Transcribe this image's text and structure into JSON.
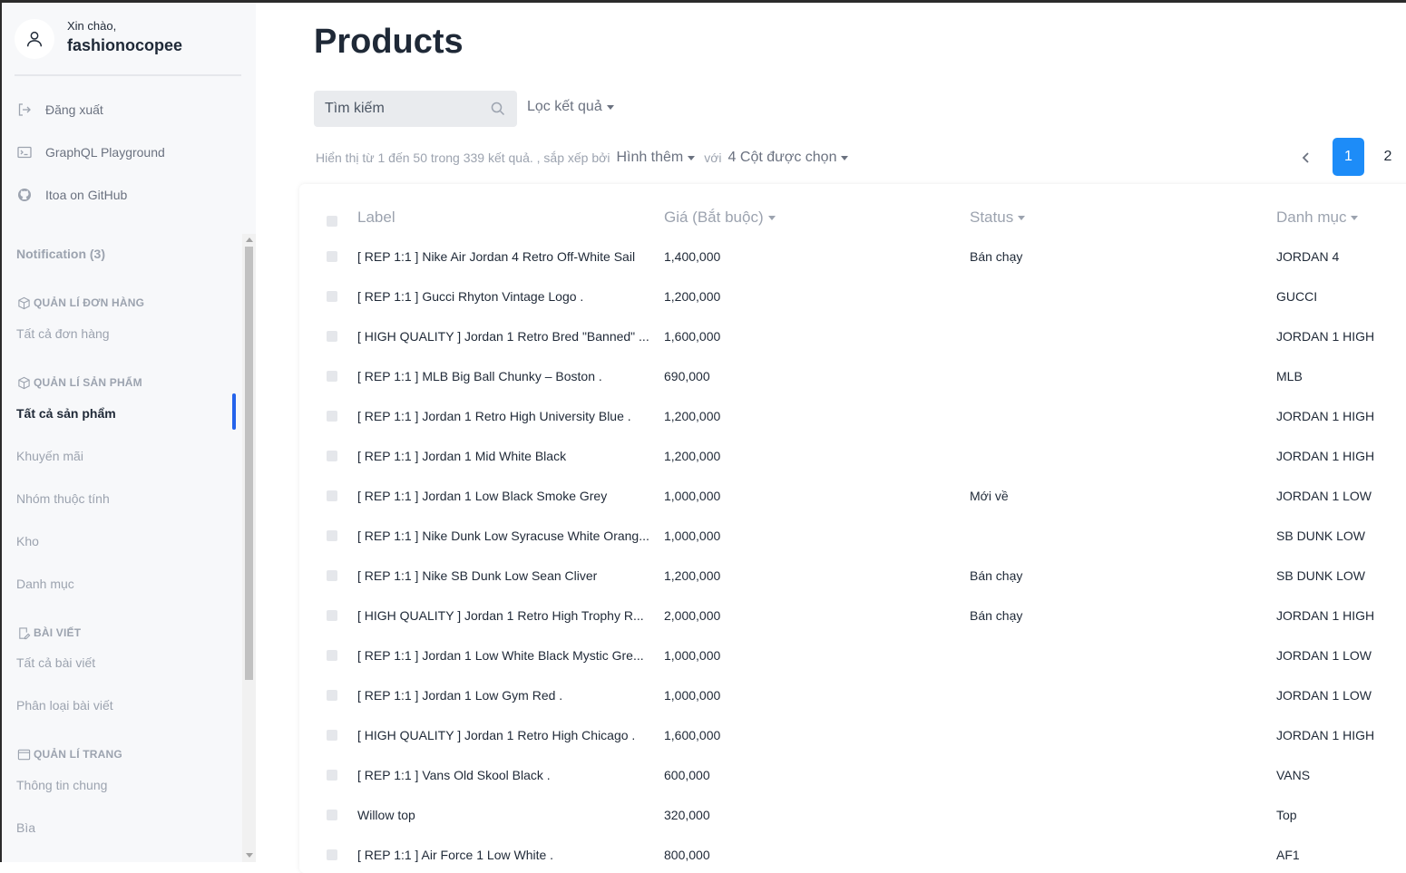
{
  "user": {
    "greeting": "Xin chào,",
    "name": "fashionocopee"
  },
  "sidebar": {
    "links": [
      {
        "label": "Đăng xuất",
        "icon": "logout-icon"
      },
      {
        "label": "GraphQL Playground",
        "icon": "terminal-icon"
      },
      {
        "label": "Itoa on GitHub",
        "icon": "github-icon"
      }
    ],
    "notification": "Notification (3)",
    "sections": [
      {
        "title": "QUẢN LÍ ĐƠN HÀNG",
        "icon": "box-icon",
        "items": [
          "Tất cả đơn hàng"
        ]
      },
      {
        "title": "QUẢN LÍ SẢN PHẨM",
        "icon": "box-icon",
        "items": [
          "Tất cả sản phẩm",
          "Khuyến mãi",
          "Nhóm thuộc tính",
          "Kho",
          "Danh mục"
        ]
      },
      {
        "title": "BÀI VIẾT",
        "icon": "edit-document-icon",
        "items": [
          "Tất cả bài viết",
          "Phân loại bài viết"
        ]
      },
      {
        "title": "QUẢN LÍ TRANG",
        "icon": "window-icon",
        "items": [
          "Thông tin chung",
          "Bìa"
        ]
      }
    ],
    "active_item": "Tất cả sản phẩm"
  },
  "page": {
    "title": "Products"
  },
  "search": {
    "placeholder": "Tìm kiếm"
  },
  "filter": {
    "label": "Lọc kết quả"
  },
  "info": {
    "text": "Hiển thị từ 1 đến 50 trong 339 kết quả. , sắp xếp bởi",
    "sort_by": "Hình thêm",
    "with": "với",
    "columns": "4 Cột được chọn"
  },
  "pagination": {
    "current": "1",
    "next": "2"
  },
  "table": {
    "headers": [
      "Label",
      "Giá (Bắt buộc)",
      "Status",
      "Danh mục"
    ],
    "rows": [
      [
        "[ REP 1:1 ] Nike Air Jordan 4 Retro Off-White Sail",
        "1,400,000",
        "Bán chạy",
        "JORDAN 4"
      ],
      [
        "[ REP 1:1 ] Gucci Rhyton Vintage Logo .",
        "1,200,000",
        "",
        "GUCCI"
      ],
      [
        "[ HIGH QUALITY ] Jordan 1 Retro Bred \"Banned\" ...",
        "1,600,000",
        "",
        "JORDAN 1 HIGH"
      ],
      [
        "[ REP 1:1 ] MLB Big Ball Chunky – Boston .",
        "690,000",
        "",
        "MLB"
      ],
      [
        "[ REP 1:1 ] Jordan 1 Retro High University Blue .",
        "1,200,000",
        "",
        "JORDAN 1 HIGH"
      ],
      [
        "[ REP 1:1 ] Jordan 1 Mid White Black",
        "1,200,000",
        "",
        "JORDAN 1 HIGH"
      ],
      [
        "[ REP 1:1 ] Jordan 1 Low Black Smoke Grey",
        "1,000,000",
        "Mới về",
        "JORDAN 1 LOW"
      ],
      [
        "[ REP 1:1 ] Nike Dunk Low Syracuse White Orang...",
        "1,000,000",
        "",
        "SB DUNK LOW"
      ],
      [
        "[ REP 1:1 ] Nike SB Dunk Low Sean Cliver",
        "1,200,000",
        "Bán chạy",
        "SB DUNK LOW"
      ],
      [
        "[ HIGH QUALITY ] Jordan 1 Retro High Trophy R...",
        "2,000,000",
        "Bán chạy",
        "JORDAN 1 HIGH"
      ],
      [
        "[ REP 1:1 ] Jordan 1 Low White Black Mystic Gre...",
        "1,000,000",
        "",
        "JORDAN 1 LOW"
      ],
      [
        "[ REP 1:1 ] Jordan 1 Low Gym Red .",
        "1,000,000",
        "",
        "JORDAN 1 LOW"
      ],
      [
        "[ HIGH QUALITY ] Jordan 1 Retro High Chicago .",
        "1,600,000",
        "",
        "JORDAN 1 HIGH"
      ],
      [
        "[ REP 1:1 ] Vans Old Skool Black .",
        "600,000",
        "",
        "VANS"
      ],
      [
        "Willow top",
        "320,000",
        "",
        "Top"
      ],
      [
        "[ REP 1:1 ] Air Force 1 Low White .",
        "800,000",
        "",
        "AF1"
      ]
    ]
  },
  "colors": {
    "accent": "#1d8cf8",
    "active_bar": "#2563eb",
    "sidebar_bg": "#f7f8fa"
  }
}
